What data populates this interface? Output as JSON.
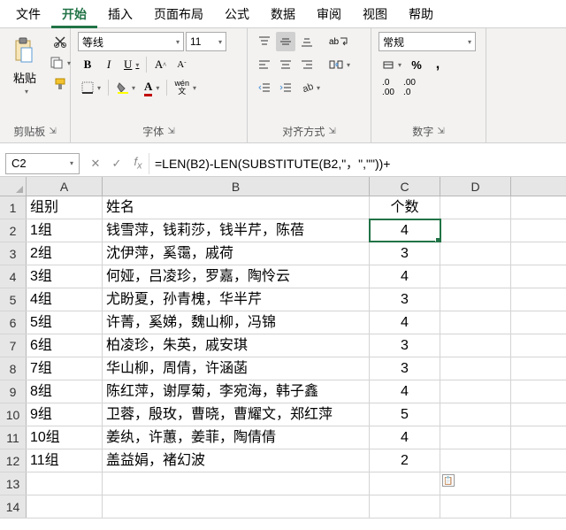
{
  "menu": {
    "items": [
      "文件",
      "开始",
      "插入",
      "页面布局",
      "公式",
      "数据",
      "审阅",
      "视图",
      "帮助"
    ],
    "active_index": 1
  },
  "ribbon": {
    "clipboard": {
      "label": "剪贴板",
      "paste": "粘贴"
    },
    "font": {
      "label": "字体",
      "family": "等线",
      "size": "11",
      "bold": "B",
      "italic": "I",
      "underline": "U",
      "wen": "wén"
    },
    "align": {
      "label": "对齐方式",
      "wrap_char": "ab"
    },
    "number": {
      "label": "数字",
      "format": "常规"
    }
  },
  "name_box": "C2",
  "formula": "=LEN(B2)-LEN(SUBSTITUTE(B2,\"，\",\"\"))+",
  "columns": [
    "A",
    "B",
    "C",
    "D"
  ],
  "header_row": {
    "A": "组别",
    "B": "姓名",
    "C": "个数"
  },
  "chart_data": {
    "type": "table",
    "columns": [
      "组别",
      "姓名",
      "个数"
    ],
    "rows": [
      {
        "A": "1组",
        "B": "钱雪萍，钱莉莎，钱半芹，陈蓓",
        "C": "4"
      },
      {
        "A": "2组",
        "B": "沈伊萍，奚霭，戚荷",
        "C": "3"
      },
      {
        "A": "3组",
        "B": "何娅，吕凌珍，罗嘉，陶怜云",
        "C": "4"
      },
      {
        "A": "4组",
        "B": "尤盼夏，孙青槐，华半芹",
        "C": "3"
      },
      {
        "A": "5组",
        "B": "许菁，奚娣，魏山柳，冯锦",
        "C": "4"
      },
      {
        "A": "6组",
        "B": "柏凌珍，朱英，戚安琪",
        "C": "3"
      },
      {
        "A": "7组",
        "B": "华山柳，周倩，许涵菡",
        "C": "3"
      },
      {
        "A": "8组",
        "B": "陈红萍，谢厚菊，李宛海，韩子鑫",
        "C": "4"
      },
      {
        "A": "9组",
        "B": "卫蓉，殷玫，曹晓，曹耀文，郑红萍",
        "C": "5"
      },
      {
        "A": "10组",
        "B": "姜纨，许蕙，姜菲，陶倩倩",
        "C": "4"
      },
      {
        "A": "11组",
        "B": "盖益娟，褚幻波",
        "C": "2"
      }
    ]
  },
  "last_rows": [
    13,
    14
  ]
}
